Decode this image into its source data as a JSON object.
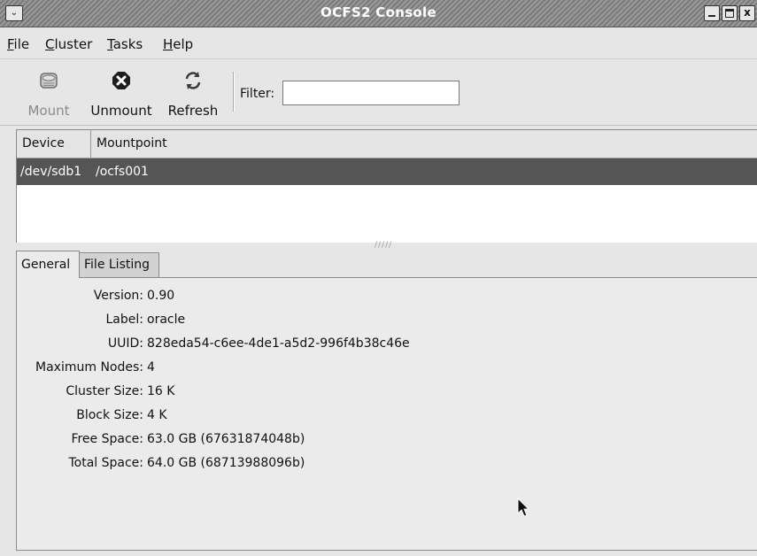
{
  "window": {
    "title": "OCFS2 Console",
    "close_glyph": "x"
  },
  "menubar": {
    "items": [
      {
        "label": "File"
      },
      {
        "label": "Cluster"
      },
      {
        "label": "Tasks"
      },
      {
        "label": "Help"
      }
    ]
  },
  "toolbar": {
    "mount_label": "Mount",
    "unmount_label": "Unmount",
    "refresh_label": "Refresh",
    "filter_label": "Filter:",
    "filter_value": "",
    "icons": {
      "mount": "disk-icon",
      "unmount": "stop-icon",
      "refresh": "refresh-icon"
    }
  },
  "device_list": {
    "columns": [
      "Device",
      "Mountpoint"
    ],
    "rows": [
      {
        "device": "/dev/sdb1",
        "mountpoint": "/ocfs001",
        "selected": true
      }
    ]
  },
  "tabs": [
    {
      "label": "General",
      "active": true
    },
    {
      "label": "File Listing",
      "active": false
    }
  ],
  "general": {
    "fields": [
      {
        "key": "Version:",
        "value": "0.90"
      },
      {
        "key": "Label:",
        "value": "oracle"
      },
      {
        "key": "UUID:",
        "value": "828eda54-c6ee-4de1-a5d2-996f4b38c46e"
      },
      {
        "key": "Maximum Nodes:",
        "value": "4"
      },
      {
        "key": "Cluster Size:",
        "value": "16 K"
      },
      {
        "key": "Block Size:",
        "value": "4 K"
      },
      {
        "key": "Free Space:",
        "value": "63.0 GB (67631874048b)"
      },
      {
        "key": "Total Space:",
        "value": "64.0 GB (68713988096b)"
      }
    ]
  },
  "colors": {
    "selection": "#555555",
    "window_bg": "#e6e6e6"
  }
}
